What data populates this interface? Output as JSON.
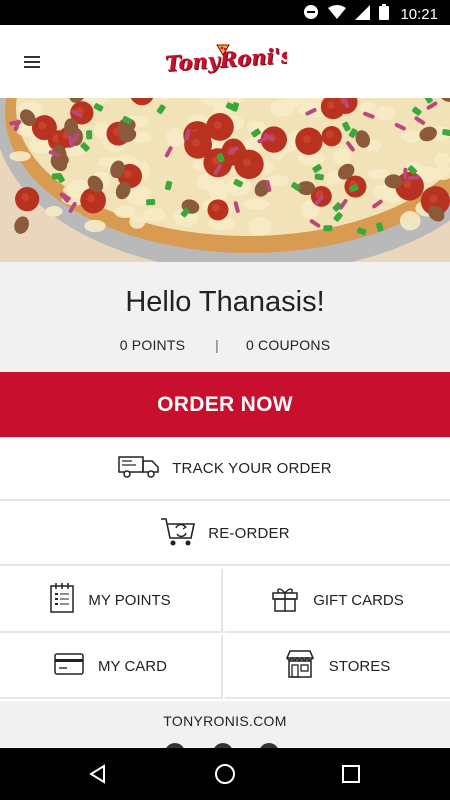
{
  "status_bar": {
    "time": "10:21",
    "icons": [
      "do-not-disturb-icon",
      "wifi-icon",
      "signal-icon",
      "battery-icon"
    ]
  },
  "app_bar": {
    "logo_text": "TonyRoni's",
    "menu_icon": "hamburger-menu-icon"
  },
  "greeting": {
    "text": "Hello Thanasis!",
    "points": "0 POINTS",
    "separator": "|",
    "coupons": "0 COUPONS"
  },
  "actions": {
    "order_now": "ORDER NOW",
    "track_order": "TRACK YOUR ORDER",
    "reorder": "RE-ORDER",
    "my_points": "MY POINTS",
    "gift_cards": "GIFT CARDS",
    "my_card": "MY CARD",
    "stores": "STORES"
  },
  "footer": {
    "website": "TONYRONIS.COM"
  },
  "colors": {
    "brand_red": "#c8102e",
    "panel_gray": "#f1f1f1"
  }
}
